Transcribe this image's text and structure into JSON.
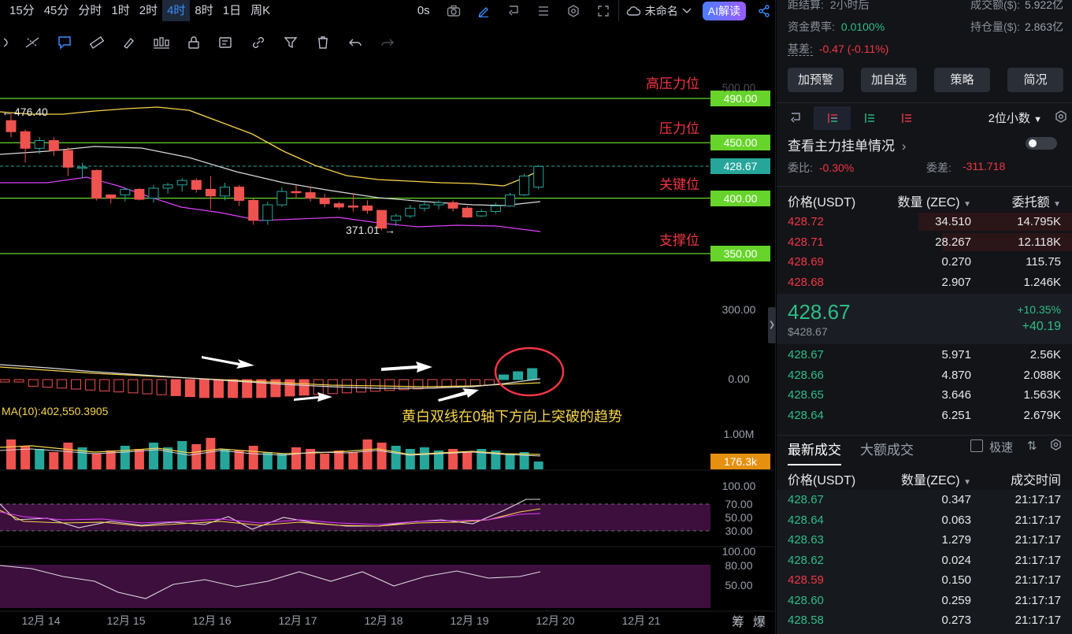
{
  "toolbar": {
    "timeframes": [
      "15分",
      "45分",
      "分时",
      "1时",
      "2时",
      "4时",
      "8时",
      "1日",
      "周K"
    ],
    "active_timeframe": "4时",
    "replay_label": "0s",
    "layout_name": "未命名",
    "ai_label": "AI解读"
  },
  "chart": {
    "price_axis": [
      "500.00",
      "300.00",
      "0.00",
      "1.00M",
      "100.00",
      "70.00",
      "50.00",
      "30.00",
      "100.00",
      "80.00",
      "50.00"
    ],
    "levels": [
      {
        "price": "490.00",
        "label": "高压力位"
      },
      {
        "price": "450.00",
        "label": "压力位"
      },
      {
        "price": "400.00",
        "label": "关键位"
      },
      {
        "price": "350.00",
        "label": "支撑位"
      }
    ],
    "current_price_tag": "428.67",
    "volume_tag": "176.3k",
    "high_marker": "476.40",
    "low_marker": "371.01",
    "ma_label": "MA(10):402,550.3905",
    "annotation": "黄白双线在0轴下方向上突破的趋势",
    "time_axis": [
      "12月 14",
      "12月 15",
      "12月 16",
      "12月 17",
      "12月 18",
      "12月 19",
      "12月 20",
      "12月 21"
    ],
    "corner_labels": [
      "筹",
      "爆"
    ],
    "colors": {
      "up": "#26a69a",
      "down": "#ef5350",
      "level_line": "#66d42b",
      "ma_yellow": "#f7d44a",
      "ma_white": "#d9d9d9",
      "ma_pink": "#e040fb"
    }
  },
  "chart_data": {
    "type": "candlestick",
    "x_categories": [
      "12月 14",
      "12月 15",
      "12月 16",
      "12月 17",
      "12月 18",
      "12月 19",
      "12月 20"
    ],
    "candles_ohlc": [
      [
        470,
        476.4,
        455,
        460,
        "d"
      ],
      [
        460,
        462,
        432,
        445,
        "d"
      ],
      [
        445,
        455,
        440,
        452,
        "u"
      ],
      [
        452,
        455,
        438,
        443,
        "d"
      ],
      [
        443,
        446,
        420,
        428,
        "d"
      ],
      [
        428,
        432,
        418,
        428,
        "u"
      ],
      [
        425,
        426,
        398,
        400,
        "d"
      ],
      [
        400,
        402,
        395,
        403,
        "d"
      ],
      [
        403,
        409,
        397,
        408,
        "u"
      ],
      [
        408,
        409,
        398,
        399,
        "d"
      ],
      [
        400,
        412,
        396,
        409,
        "u"
      ],
      [
        409,
        414,
        404,
        412,
        "u"
      ],
      [
        412,
        418,
        406,
        416,
        "u"
      ],
      [
        416,
        418,
        405,
        408,
        "d"
      ],
      [
        408,
        420,
        390,
        402,
        "d"
      ],
      [
        402,
        414,
        398,
        410,
        "u"
      ],
      [
        410,
        412,
        393,
        398,
        "d"
      ],
      [
        398,
        400,
        376,
        380,
        "d"
      ],
      [
        380,
        397,
        376,
        394,
        "u"
      ],
      [
        394,
        410,
        392,
        406,
        "u"
      ],
      [
        406,
        412,
        400,
        405,
        "d"
      ],
      [
        405,
        410,
        397,
        400,
        "d"
      ],
      [
        400,
        404,
        392,
        395,
        "d"
      ],
      [
        395,
        397,
        390,
        392,
        "d"
      ],
      [
        392,
        404,
        388,
        393,
        "d"
      ],
      [
        393,
        398,
        386,
        389,
        "d"
      ],
      [
        389,
        388,
        371.01,
        373,
        "d"
      ],
      [
        380,
        386,
        375,
        384,
        "u"
      ],
      [
        384,
        394,
        382,
        391,
        "u"
      ],
      [
        391,
        398,
        388,
        394,
        "u"
      ],
      [
        394,
        398,
        390,
        396,
        "u"
      ],
      [
        396,
        398,
        388,
        391,
        "d"
      ],
      [
        391,
        393,
        382,
        383,
        "d"
      ],
      [
        384,
        390,
        383,
        388,
        "u"
      ],
      [
        388,
        396,
        386,
        393,
        "u"
      ],
      [
        393,
        405,
        392,
        403,
        "u"
      ],
      [
        403,
        422,
        402,
        420,
        "u"
      ],
      [
        410,
        430,
        408,
        428.67,
        "u"
      ]
    ],
    "horizontal_levels": [
      490,
      450,
      400,
      350
    ],
    "ylim": [
      300,
      500
    ]
  },
  "right": {
    "stats": {
      "settle_label": "距结算:",
      "settle_value": "2小时后",
      "turnover_label": "成交额($):",
      "turnover_value": "5.922亿",
      "funding_label": "资金费率:",
      "funding_value": "0.0100%",
      "oi_label": "持仓量($):",
      "oi_value": "2.863亿",
      "basis_label": "基差:",
      "basis_value": "-0.47 (-0.11%)"
    },
    "buttons": [
      "加预警",
      "加自选",
      "策略",
      "简况"
    ],
    "decimal_label": "2位小数",
    "main_orders_label": "查看主力挂单情况",
    "ratio_label": "委比:",
    "ratio_value": "-0.30%",
    "diff_label": "委差:",
    "diff_value": "-311.718",
    "ob_headers": {
      "price": "价格(USDT)",
      "qty": "数量 (ZEC)",
      "total": "委托额"
    },
    "asks": [
      {
        "p": "428.72",
        "q": "34.510",
        "t": "14.795K",
        "w": 0.52
      },
      {
        "p": "428.71",
        "q": "28.267",
        "t": "12.118K",
        "w": 0.44
      },
      {
        "p": "428.69",
        "q": "0.270",
        "t": "115.75",
        "w": 0.0
      },
      {
        "p": "428.68",
        "q": "2.907",
        "t": "1.246K",
        "w": 0.0
      }
    ],
    "mid": {
      "price": "428.67",
      "usd": "$428.67",
      "change_pct": "+10.35%",
      "change": "+40.19"
    },
    "bids": [
      {
        "p": "428.67",
        "q": "5.971",
        "t": "2.56K"
      },
      {
        "p": "428.66",
        "q": "4.870",
        "t": "2.088K"
      },
      {
        "p": "428.65",
        "q": "3.646",
        "t": "1.563K"
      },
      {
        "p": "428.64",
        "q": "6.251",
        "t": "2.679K"
      }
    ],
    "trade_tabs": {
      "latest": "最新成交",
      "large": "大额成交",
      "fast": "极速"
    },
    "trade_headers": {
      "price": "价格(USDT)",
      "qty": "数量(ZEC)",
      "time": "成交时间"
    },
    "trades": [
      {
        "p": "428.67",
        "q": "0.347",
        "t": "21:17:17",
        "side": "buy"
      },
      {
        "p": "428.64",
        "q": "0.063",
        "t": "21:17:17",
        "side": "buy"
      },
      {
        "p": "428.63",
        "q": "1.279",
        "t": "21:17:17",
        "side": "buy"
      },
      {
        "p": "428.62",
        "q": "0.024",
        "t": "21:17:17",
        "side": "buy"
      },
      {
        "p": "428.59",
        "q": "0.150",
        "t": "21:17:17",
        "side": "sell"
      },
      {
        "p": "428.60",
        "q": "0.259",
        "t": "21:17:17",
        "side": "buy"
      },
      {
        "p": "428.58",
        "q": "0.273",
        "t": "21:17:17",
        "side": "buy"
      }
    ]
  }
}
